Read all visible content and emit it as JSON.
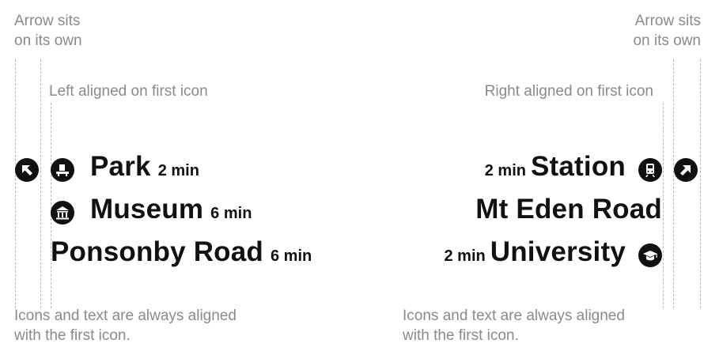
{
  "left": {
    "arrow_note": [
      "Arrow sits",
      "on its own"
    ],
    "align_note": "Left aligned on first icon",
    "rows": [
      {
        "dest": "Park",
        "time": "2 min",
        "icon": "park-bench-icon"
      },
      {
        "dest": "Museum",
        "time": "6 min",
        "icon": "museum-icon"
      },
      {
        "dest": "Ponsonby Road",
        "time": "6 min"
      }
    ],
    "arrow_icon": "arrow-up-left-icon",
    "footer": [
      "Icons and text are always aligned",
      "with the first icon."
    ]
  },
  "right": {
    "arrow_note": [
      "Arrow sits",
      "on its own"
    ],
    "align_note": "Right aligned on first icon",
    "rows": [
      {
        "dest": "Station",
        "time": "2 min",
        "icon": "train-icon"
      },
      {
        "dest": "Mt Eden Road"
      },
      {
        "dest": "University",
        "time": "2 min",
        "icon": "graduation-cap-icon"
      }
    ],
    "arrow_icon": "arrow-up-right-icon",
    "footer": [
      "Icons and text are always aligned",
      "with the first icon."
    ]
  }
}
